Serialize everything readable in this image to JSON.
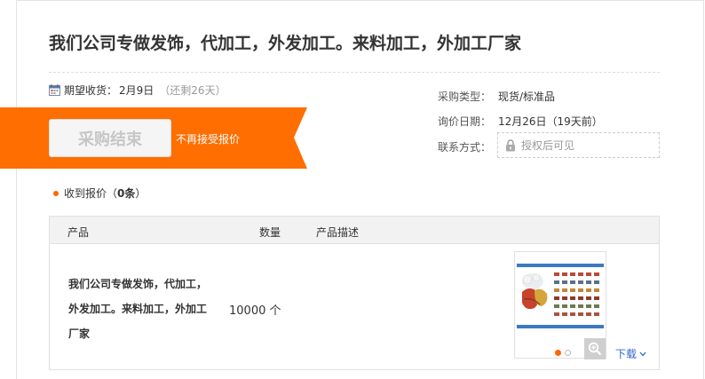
{
  "title": "我们公司专做发饰，代加工，外发加工。来料加工，外加工厂家",
  "delivery": {
    "label": "期望收货：",
    "date": "2月9日",
    "remaining": "（还剩26天）"
  },
  "status": {
    "button_label": "采购结束",
    "note": "不再接受报价",
    "banner_color": "#ff6600"
  },
  "info": {
    "purchase_type_label": "采购类型：",
    "purchase_type_value": "现货/标准品",
    "inquiry_date_label": "询价日期：",
    "inquiry_date_value": "12月26日（19天前）",
    "contact_label": "联系方式：",
    "contact_value": "授权后可见"
  },
  "quotes": {
    "prefix": "收到报价（",
    "count": "0条",
    "suffix": "）"
  },
  "table": {
    "headers": {
      "product": "产品",
      "quantity": "数量",
      "description": "产品描述"
    },
    "rows": [
      {
        "product": "我们公司专做发饰，代加工，外发加工。来料加工，外加工厂家",
        "quantity": "10000 个"
      }
    ]
  },
  "attachment": {
    "download_label": "下载"
  }
}
